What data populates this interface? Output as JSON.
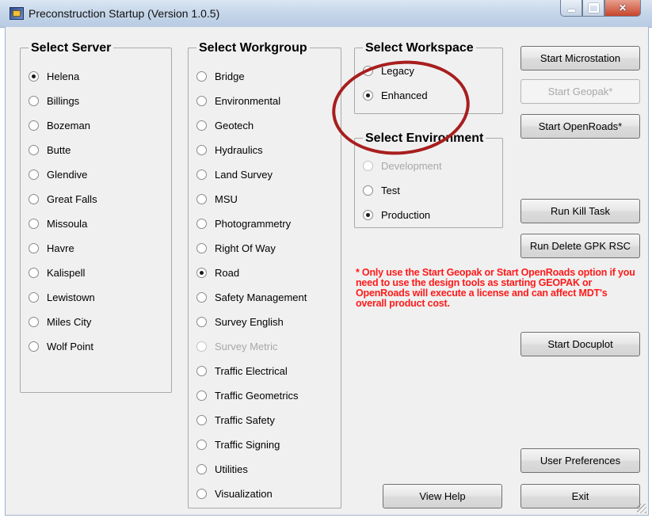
{
  "window": {
    "title": "Preconstruction Startup (Version 1.0.5)"
  },
  "server": {
    "title": "Select Server",
    "options": [
      {
        "label": "Helena",
        "checked": true
      },
      {
        "label": "Billings"
      },
      {
        "label": "Bozeman"
      },
      {
        "label": "Butte"
      },
      {
        "label": "Glendive"
      },
      {
        "label": "Great Falls"
      },
      {
        "label": "Missoula"
      },
      {
        "label": "Havre"
      },
      {
        "label": "Kalispell"
      },
      {
        "label": "Lewistown"
      },
      {
        "label": "Miles City"
      },
      {
        "label": "Wolf Point"
      }
    ]
  },
  "workgroup": {
    "title": "Select Workgroup",
    "options": [
      {
        "label": "Bridge"
      },
      {
        "label": "Environmental"
      },
      {
        "label": "Geotech"
      },
      {
        "label": "Hydraulics"
      },
      {
        "label": "Land Survey"
      },
      {
        "label": "MSU"
      },
      {
        "label": "Photogrammetry"
      },
      {
        "label": "Right Of Way"
      },
      {
        "label": "Road",
        "checked": true
      },
      {
        "label": "Safety Management"
      },
      {
        "label": "Survey English"
      },
      {
        "label": "Survey Metric",
        "disabled": true
      },
      {
        "label": "Traffic Electrical"
      },
      {
        "label": "Traffic Geometrics"
      },
      {
        "label": "Traffic Safety"
      },
      {
        "label": "Traffic Signing"
      },
      {
        "label": "Utilities"
      },
      {
        "label": "Visualization"
      }
    ]
  },
  "workspace": {
    "title": "Select Workspace",
    "options": [
      {
        "label": "Legacy"
      },
      {
        "label": "Enhanced",
        "checked": true
      }
    ]
  },
  "environment": {
    "title": "Select Environment",
    "options": [
      {
        "label": "Development",
        "disabled": true
      },
      {
        "label": "Test"
      },
      {
        "label": "Production",
        "checked": true
      }
    ]
  },
  "buttons": {
    "start_microstation": "Start Microstation",
    "start_geopak": "Start Geopak*",
    "start_openroads": "Start OpenRoads*",
    "run_kill_task": "Run Kill Task",
    "run_delete_gpk": "Run Delete GPK RSC",
    "start_docuplot": "Start Docuplot",
    "user_preferences": "User Preferences",
    "view_help": "View Help",
    "exit": "Exit"
  },
  "warning": "* Only use the Start Geopak or Start OpenRoads option if you need to use the design tools as starting GEOPAK or OpenRoads will execute a license and can affect MDT's overall product cost.",
  "colors": {
    "warning_text": "#ff1a1a",
    "highlight_circle": "#a81e1e"
  }
}
